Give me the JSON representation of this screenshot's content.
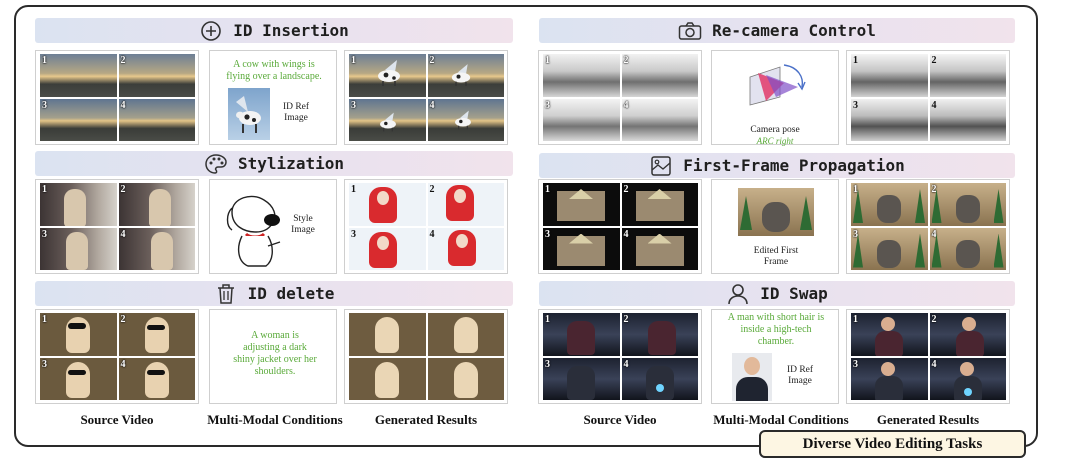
{
  "sections": [
    {
      "id": "id-insertion",
      "title": "ID Insertion",
      "icon": "plus-circle-icon",
      "source_labels": [
        "1",
        "2",
        "3",
        "4"
      ],
      "result_labels": [
        "1",
        "2",
        "3",
        "4"
      ],
      "condition": {
        "prompt": "A cow with wings is flying over a landscape.",
        "caption": "ID Ref Image"
      }
    },
    {
      "id": "stylization",
      "title": "Stylization",
      "icon": "palette-icon",
      "source_labels": [
        "1",
        "2",
        "3",
        "4"
      ],
      "result_labels": [
        "1",
        "2",
        "3",
        "4"
      ],
      "condition": {
        "caption": "Style Image"
      }
    },
    {
      "id": "id-delete",
      "title": "ID delete",
      "icon": "trash-icon",
      "source_labels": [
        "1",
        "2",
        "3",
        "4"
      ],
      "result_labels": [],
      "condition": {
        "prompt": "A woman is adjusting a dark shiny jacket over her shoulders."
      }
    },
    {
      "id": "re-camera",
      "title": "Re-camera Control",
      "icon": "camera-icon",
      "source_labels": [
        "1",
        "2",
        "3",
        "4"
      ],
      "result_labels": [
        "1",
        "2",
        "3",
        "4"
      ],
      "condition": {
        "caption": "Camera pose",
        "subcaption": "ARC right"
      }
    },
    {
      "id": "first-frame",
      "title": "First-Frame Propagation",
      "icon": "image-frame-icon",
      "source_labels": [
        "1",
        "2",
        "3",
        "4"
      ],
      "result_labels": [
        "1",
        "2",
        "3",
        "4"
      ],
      "condition": {
        "caption": "Edited First Frame"
      }
    },
    {
      "id": "id-swap",
      "title": "ID Swap",
      "icon": "person-icon",
      "source_labels": [
        "1",
        "2",
        "3",
        "4"
      ],
      "result_labels": [
        "1",
        "2",
        "3",
        "4"
      ],
      "condition": {
        "prompt": "A man with short hair is inside a high-tech chamber.",
        "caption": "ID Ref Image"
      }
    }
  ],
  "footer": {
    "left": {
      "source": "Source Video",
      "conditions": "Multi-Modal Conditions",
      "results": "Generated Results"
    },
    "right": {
      "source": "Source Video",
      "conditions": "Multi-Modal Conditions",
      "results": "Generated Results"
    }
  },
  "badge": "Diverse Video Editing Tasks",
  "colors": {
    "condition_text": "#5aaa3a",
    "header_gradient_start": "#dbe3f1",
    "header_gradient_end": "#f1e3ec"
  }
}
